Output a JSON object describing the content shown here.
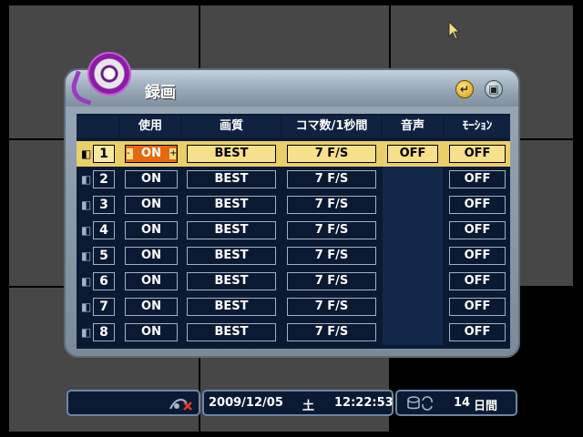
{
  "window": {
    "title": "録画",
    "enter_button": "enter",
    "close_button": "close"
  },
  "table": {
    "headers": [
      "使用",
      "画質",
      "コマ数/1秒間",
      "音声",
      "ﾓｰｼｮﾝ"
    ],
    "rows": [
      {
        "ch": "1",
        "use": "ON",
        "quality": "BEST",
        "frames": "7 F/S",
        "audio": "OFF",
        "motion": "OFF"
      },
      {
        "ch": "2",
        "use": "ON",
        "quality": "BEST",
        "frames": "7 F/S",
        "audio": "",
        "motion": "OFF"
      },
      {
        "ch": "3",
        "use": "ON",
        "quality": "BEST",
        "frames": "7 F/S",
        "audio": "",
        "motion": "OFF"
      },
      {
        "ch": "4",
        "use": "ON",
        "quality": "BEST",
        "frames": "7 F/S",
        "audio": "",
        "motion": "OFF"
      },
      {
        "ch": "5",
        "use": "ON",
        "quality": "BEST",
        "frames": "7 F/S",
        "audio": "",
        "motion": "OFF"
      },
      {
        "ch": "6",
        "use": "ON",
        "quality": "BEST",
        "frames": "7 F/S",
        "audio": "",
        "motion": "OFF"
      },
      {
        "ch": "7",
        "use": "ON",
        "quality": "BEST",
        "frames": "7 F/S",
        "audio": "",
        "motion": "OFF"
      },
      {
        "ch": "8",
        "use": "ON",
        "quality": "BEST",
        "frames": "7 F/S",
        "audio": "",
        "motion": "OFF"
      }
    ],
    "stepper_minus": "-",
    "stepper_plus": "+"
  },
  "status": {
    "date": "2009/12/05",
    "weekday": "土",
    "time": "12:22:53",
    "days": "14",
    "days_unit": "日間"
  },
  "colors": {
    "selected_row": "#e9ce6a",
    "on_active": "#e46a12",
    "table_bg": "#0b1a33"
  }
}
